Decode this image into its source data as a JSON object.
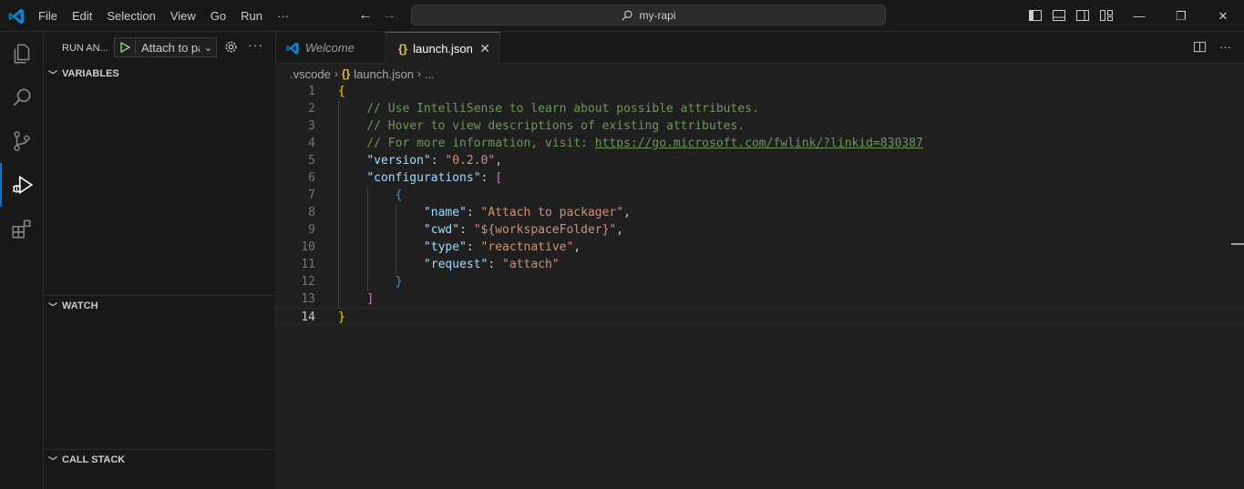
{
  "titlebar": {
    "menu": [
      "File",
      "Edit",
      "Selection",
      "View",
      "Go",
      "Run",
      "···"
    ],
    "search": "my-rapi"
  },
  "sidebar": {
    "title": "RUN AN...",
    "config_name": "Attach to packager",
    "sections": {
      "variables": "VARIABLES",
      "watch": "WATCH",
      "call_stack": "CALL STACK"
    }
  },
  "tabs": [
    {
      "label": "Welcome",
      "icon": "vscode-icon"
    },
    {
      "label": "launch.json",
      "icon": "json-braces-icon"
    }
  ],
  "breadcrumb": {
    "folder": ".vscode",
    "icon": "{}",
    "file": "launch.json",
    "tail": "..."
  },
  "editor": {
    "current_line": 14,
    "lines": [
      {
        "n": "1",
        "tokens": [
          {
            "t": "{",
            "c": "b1"
          }
        ]
      },
      {
        "n": "2",
        "tokens": [
          {
            "t": "    "
          },
          {
            "t": "// Use IntelliSense to learn about possible attributes.",
            "c": "c-com"
          }
        ]
      },
      {
        "n": "3",
        "tokens": [
          {
            "t": "    "
          },
          {
            "t": "// Hover to view descriptions of existing attributes.",
            "c": "c-com"
          }
        ]
      },
      {
        "n": "4",
        "tokens": [
          {
            "t": "    "
          },
          {
            "t": "// For more information, visit: ",
            "c": "c-com"
          },
          {
            "t": "https://go.microsoft.com/fwlink/?linkid=830387",
            "c": "c-link"
          }
        ]
      },
      {
        "n": "5",
        "tokens": [
          {
            "t": "    "
          },
          {
            "t": "\"version\"",
            "c": "c-key"
          },
          {
            "t": ": "
          },
          {
            "t": "\"0.2.0\"",
            "c": "c-str"
          },
          {
            "t": ","
          }
        ]
      },
      {
        "n": "6",
        "tokens": [
          {
            "t": "    "
          },
          {
            "t": "\"configurations\"",
            "c": "c-key"
          },
          {
            "t": ": "
          },
          {
            "t": "[",
            "c": "b2"
          }
        ]
      },
      {
        "n": "7",
        "tokens": [
          {
            "t": "        "
          },
          {
            "t": "{",
            "c": "b3"
          }
        ]
      },
      {
        "n": "8",
        "tokens": [
          {
            "t": "            "
          },
          {
            "t": "\"name\"",
            "c": "c-key"
          },
          {
            "t": ": "
          },
          {
            "t": "\"Attach to packager\"",
            "c": "c-str"
          },
          {
            "t": ","
          }
        ]
      },
      {
        "n": "9",
        "tokens": [
          {
            "t": "            "
          },
          {
            "t": "\"cwd\"",
            "c": "c-key"
          },
          {
            "t": ": "
          },
          {
            "t": "\"${workspaceFolder}\"",
            "c": "c-str"
          },
          {
            "t": ","
          }
        ]
      },
      {
        "n": "10",
        "tokens": [
          {
            "t": "            "
          },
          {
            "t": "\"type\"",
            "c": "c-key"
          },
          {
            "t": ": "
          },
          {
            "t": "\"reactnative\"",
            "c": "c-str"
          },
          {
            "t": ","
          }
        ]
      },
      {
        "n": "11",
        "tokens": [
          {
            "t": "            "
          },
          {
            "t": "\"request\"",
            "c": "c-key"
          },
          {
            "t": ": "
          },
          {
            "t": "\"attach\"",
            "c": "c-str"
          }
        ]
      },
      {
        "n": "12",
        "tokens": [
          {
            "t": "        "
          },
          {
            "t": "}",
            "c": "b3"
          }
        ]
      },
      {
        "n": "13",
        "tokens": [
          {
            "t": "    "
          },
          {
            "t": "]",
            "c": "b2"
          }
        ]
      },
      {
        "n": "14",
        "tokens": [
          {
            "t": "}",
            "c": "b1"
          }
        ]
      }
    ]
  },
  "colors": {
    "accent": "#0078d4",
    "comment": "#6a9955",
    "key": "#9cdcfe",
    "string": "#ce9178",
    "run_green": "#89d185"
  }
}
